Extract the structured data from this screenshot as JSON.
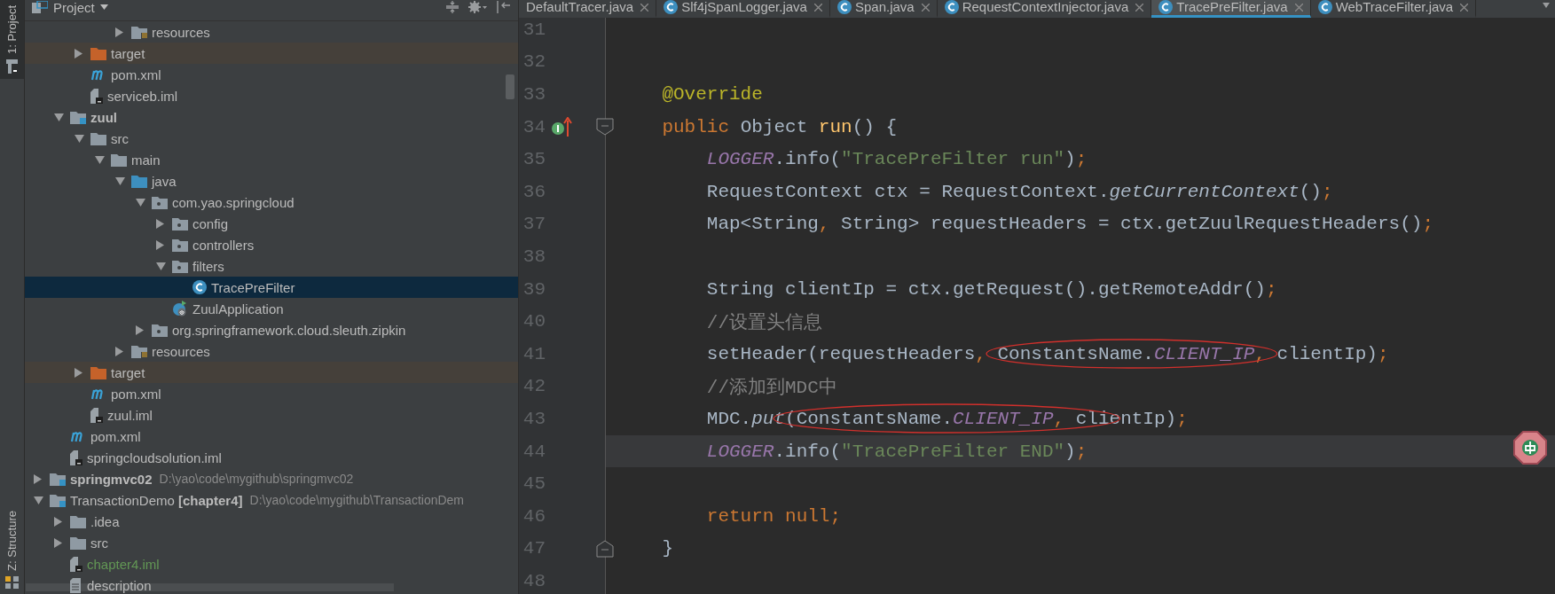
{
  "tool_strip": {
    "top_tab": {
      "label": "1: Project",
      "selected": true
    },
    "bottom_tab": {
      "label": "Z: Structure",
      "selected": false
    }
  },
  "project_panel": {
    "title": "Project",
    "tree": [
      {
        "children": [
          {
            "children": [
              {
                "children": [
                  {
                    "children": [
                      {
                        "label": "resources",
                        "kind": "resources-folder",
                        "expanded": false,
                        "selected": false
                      }
                    ]
                  }
                ]
              },
              {
                "label": "target",
                "kind": "excluded-folder",
                "expanded": false,
                "selected": false
              },
              {
                "label": "pom.xml",
                "kind": "maven",
                "selected": false
              },
              {
                "label": "serviceb.iml",
                "kind": "iml",
                "selected": false
              }
            ]
          },
          {
            "label": "zuul",
            "kind": "module",
            "bold": true,
            "expanded": true,
            "selected": false,
            "children": [
              {
                "label": "src",
                "kind": "folder",
                "expanded": true,
                "selected": false,
                "children": [
                  {
                    "label": "main",
                    "kind": "folder",
                    "expanded": true,
                    "selected": false,
                    "children": [
                      {
                        "label": "java",
                        "kind": "source-folder",
                        "expanded": true,
                        "selected": false,
                        "children": [
                          {
                            "label": "com.yao.springcloud",
                            "kind": "package",
                            "expanded": true,
                            "selected": false,
                            "children": [
                              {
                                "label": "config",
                                "kind": "package",
                                "expanded": false,
                                "selected": false
                              },
                              {
                                "label": "controllers",
                                "kind": "package",
                                "expanded": false,
                                "selected": false
                              },
                              {
                                "label": "filters",
                                "kind": "package",
                                "expanded": true,
                                "selected": false,
                                "children": [
                                  {
                                    "label": "TracePreFilter",
                                    "kind": "class",
                                    "selected": true
                                  }
                                ]
                              },
                              {
                                "label": "ZuulApplication",
                                "kind": "spring-class",
                                "selected": false
                              }
                            ]
                          },
                          {
                            "label": "org.springframework.cloud.sleuth.zipkin",
                            "kind": "package",
                            "expanded": false,
                            "selected": false
                          }
                        ]
                      },
                      {
                        "label": "resources",
                        "kind": "resources-folder",
                        "expanded": false,
                        "selected": false
                      }
                    ]
                  }
                ]
              },
              {
                "label": "target",
                "kind": "excluded-folder",
                "expanded": false,
                "selected": false
              },
              {
                "label": "pom.xml",
                "kind": "maven",
                "selected": false
              },
              {
                "label": "zuul.iml",
                "kind": "iml",
                "selected": false
              }
            ]
          },
          {
            "label": "pom.xml",
            "kind": "maven",
            "selected": false
          },
          {
            "label": "springcloudsolution.iml",
            "kind": "iml",
            "selected": false
          }
        ]
      },
      {
        "label": "springmvc02",
        "kind": "module",
        "bold": true,
        "path": "D:\\yao\\code\\mygithub\\springmvc02",
        "expanded": false,
        "selected": false
      },
      {
        "label": "TransactionDemo **[chapter4]**",
        "kind": "module",
        "bold": false,
        "path": "D:\\yao\\code\\mygithub\\TransactionDem",
        "expanded": true,
        "selected": false,
        "children": [
          {
            "label": ".idea",
            "kind": "folder",
            "expanded": false,
            "selected": false
          },
          {
            "label": "src",
            "kind": "folder",
            "expanded": false,
            "selected": false
          },
          {
            "label": "chapter4.iml",
            "kind": "iml",
            "color": "#629755",
            "selected": false
          },
          {
            "label": "description",
            "kind": "file",
            "selected": false
          }
        ]
      }
    ]
  },
  "editor": {
    "tabs": [
      {
        "label": "DefaultTracer.java",
        "selected": false
      },
      {
        "label": "Slf4jSpanLogger.java",
        "kind": "class",
        "selected": false
      },
      {
        "label": "Span.java",
        "kind": "class",
        "selected": false
      },
      {
        "label": "RequestContextInjector.java",
        "kind": "class",
        "selected": false
      },
      {
        "label": "TracePreFilter.java",
        "kind": "class",
        "selected": true
      },
      {
        "label": "WebTraceFilter.java",
        "kind": "class",
        "selected": false
      }
    ],
    "lines": [
      {
        "number": "31"
      },
      {
        "number": "32"
      },
      {
        "number": "33",
        "tokens": [
          {
            "text": "    @Override",
            "kind": "annotation"
          }
        ]
      },
      {
        "number": "34",
        "marker": {
          "kind": "override"
        },
        "fold": {
          "kind": "start"
        },
        "tokens": [
          {
            "text": "    public",
            "kind": "keyword"
          },
          {
            "text": " Object ",
            "kind": "plain"
          },
          {
            "text": "run",
            "kind": "decl"
          },
          {
            "text": "() {",
            "kind": "plain"
          }
        ]
      },
      {
        "number": "35",
        "tokens": [
          {
            "text": "        LOGGER",
            "kind": "field"
          },
          {
            "text": ".info(",
            "kind": "plain"
          },
          {
            "text": "\"TracePreFilter run\"",
            "kind": "string"
          },
          {
            "text": ")",
            "kind": "plain"
          },
          {
            "text": ";",
            "kind": "punct"
          }
        ]
      },
      {
        "number": "36",
        "tokens": [
          {
            "text": "        RequestContext ctx = RequestContext.",
            "kind": "plain"
          },
          {
            "text": "getCurrentContext",
            "kind": "static"
          },
          {
            "text": "()",
            "kind": "plain"
          },
          {
            "text": ";",
            "kind": "punct"
          }
        ]
      },
      {
        "number": "37",
        "tokens": [
          {
            "text": "        Map<String",
            "kind": "plain"
          },
          {
            "text": ",",
            "kind": "punct"
          },
          {
            "text": " String> requestHeaders = ctx.getZuulRequestHeaders()",
            "kind": "plain"
          },
          {
            "text": ";",
            "kind": "punct"
          }
        ]
      },
      {
        "number": "38"
      },
      {
        "number": "39",
        "tokens": [
          {
            "text": "        String clientIp = ctx.getRequest().getRemoteAddr()",
            "kind": "plain"
          },
          {
            "text": ";",
            "kind": "punct"
          }
        ]
      },
      {
        "number": "40",
        "tokens": [
          {
            "text": "        //设置头信息",
            "kind": "comment"
          }
        ]
      },
      {
        "number": "41",
        "tokens": [
          {
            "text": "        setHeader(requestHeaders",
            "kind": "plain"
          },
          {
            "text": ", ",
            "kind": "punct"
          },
          {
            "text": "ConstantsName.",
            "kind": "plain",
            "circled": true
          },
          {
            "text": "CLIENT_IP",
            "kind": "field",
            "circled": true
          },
          {
            "text": ",",
            "kind": "punct",
            "circled": true
          },
          {
            "text": " clientIp)",
            "kind": "plain"
          },
          {
            "text": ";",
            "kind": "punct"
          }
        ]
      },
      {
        "number": "42",
        "tokens": [
          {
            "text": "        //添加到MDC中",
            "kind": "comment"
          }
        ]
      },
      {
        "number": "43",
        "tokens": [
          {
            "text": "        MDC.",
            "kind": "plain"
          },
          {
            "text": "put",
            "kind": "static"
          },
          {
            "text": "(ConstantsName.",
            "kind": "plain",
            "circled": true
          },
          {
            "text": "CLIENT_IP",
            "kind": "field",
            "circled": true
          },
          {
            "text": ",",
            "kind": "punct",
            "circled": true
          },
          {
            "text": " cli",
            "kind": "plain",
            "circled": true
          },
          {
            "text": "entIp)",
            "kind": "plain"
          },
          {
            "text": ";",
            "kind": "punct"
          }
        ]
      },
      {
        "number": "44",
        "current": true,
        "tokens": [
          {
            "text": "        LOGGER",
            "kind": "field"
          },
          {
            "text": ".info(",
            "kind": "plain"
          },
          {
            "text": "\"TracePreFilter END\"",
            "kind": "string"
          },
          {
            "text": ")",
            "kind": "plain"
          },
          {
            "text": ";",
            "kind": "punct"
          }
        ]
      },
      {
        "number": "45"
      },
      {
        "number": "46",
        "tokens": [
          {
            "text": "        return",
            "kind": "keyword"
          },
          {
            "text": " null;",
            "kind": "keyword"
          }
        ]
      },
      {
        "number": "47",
        "fold": {
          "kind": "end"
        },
        "tokens": [
          {
            "text": "    }",
            "kind": "plain"
          }
        ]
      },
      {
        "number": "48"
      }
    ]
  }
}
